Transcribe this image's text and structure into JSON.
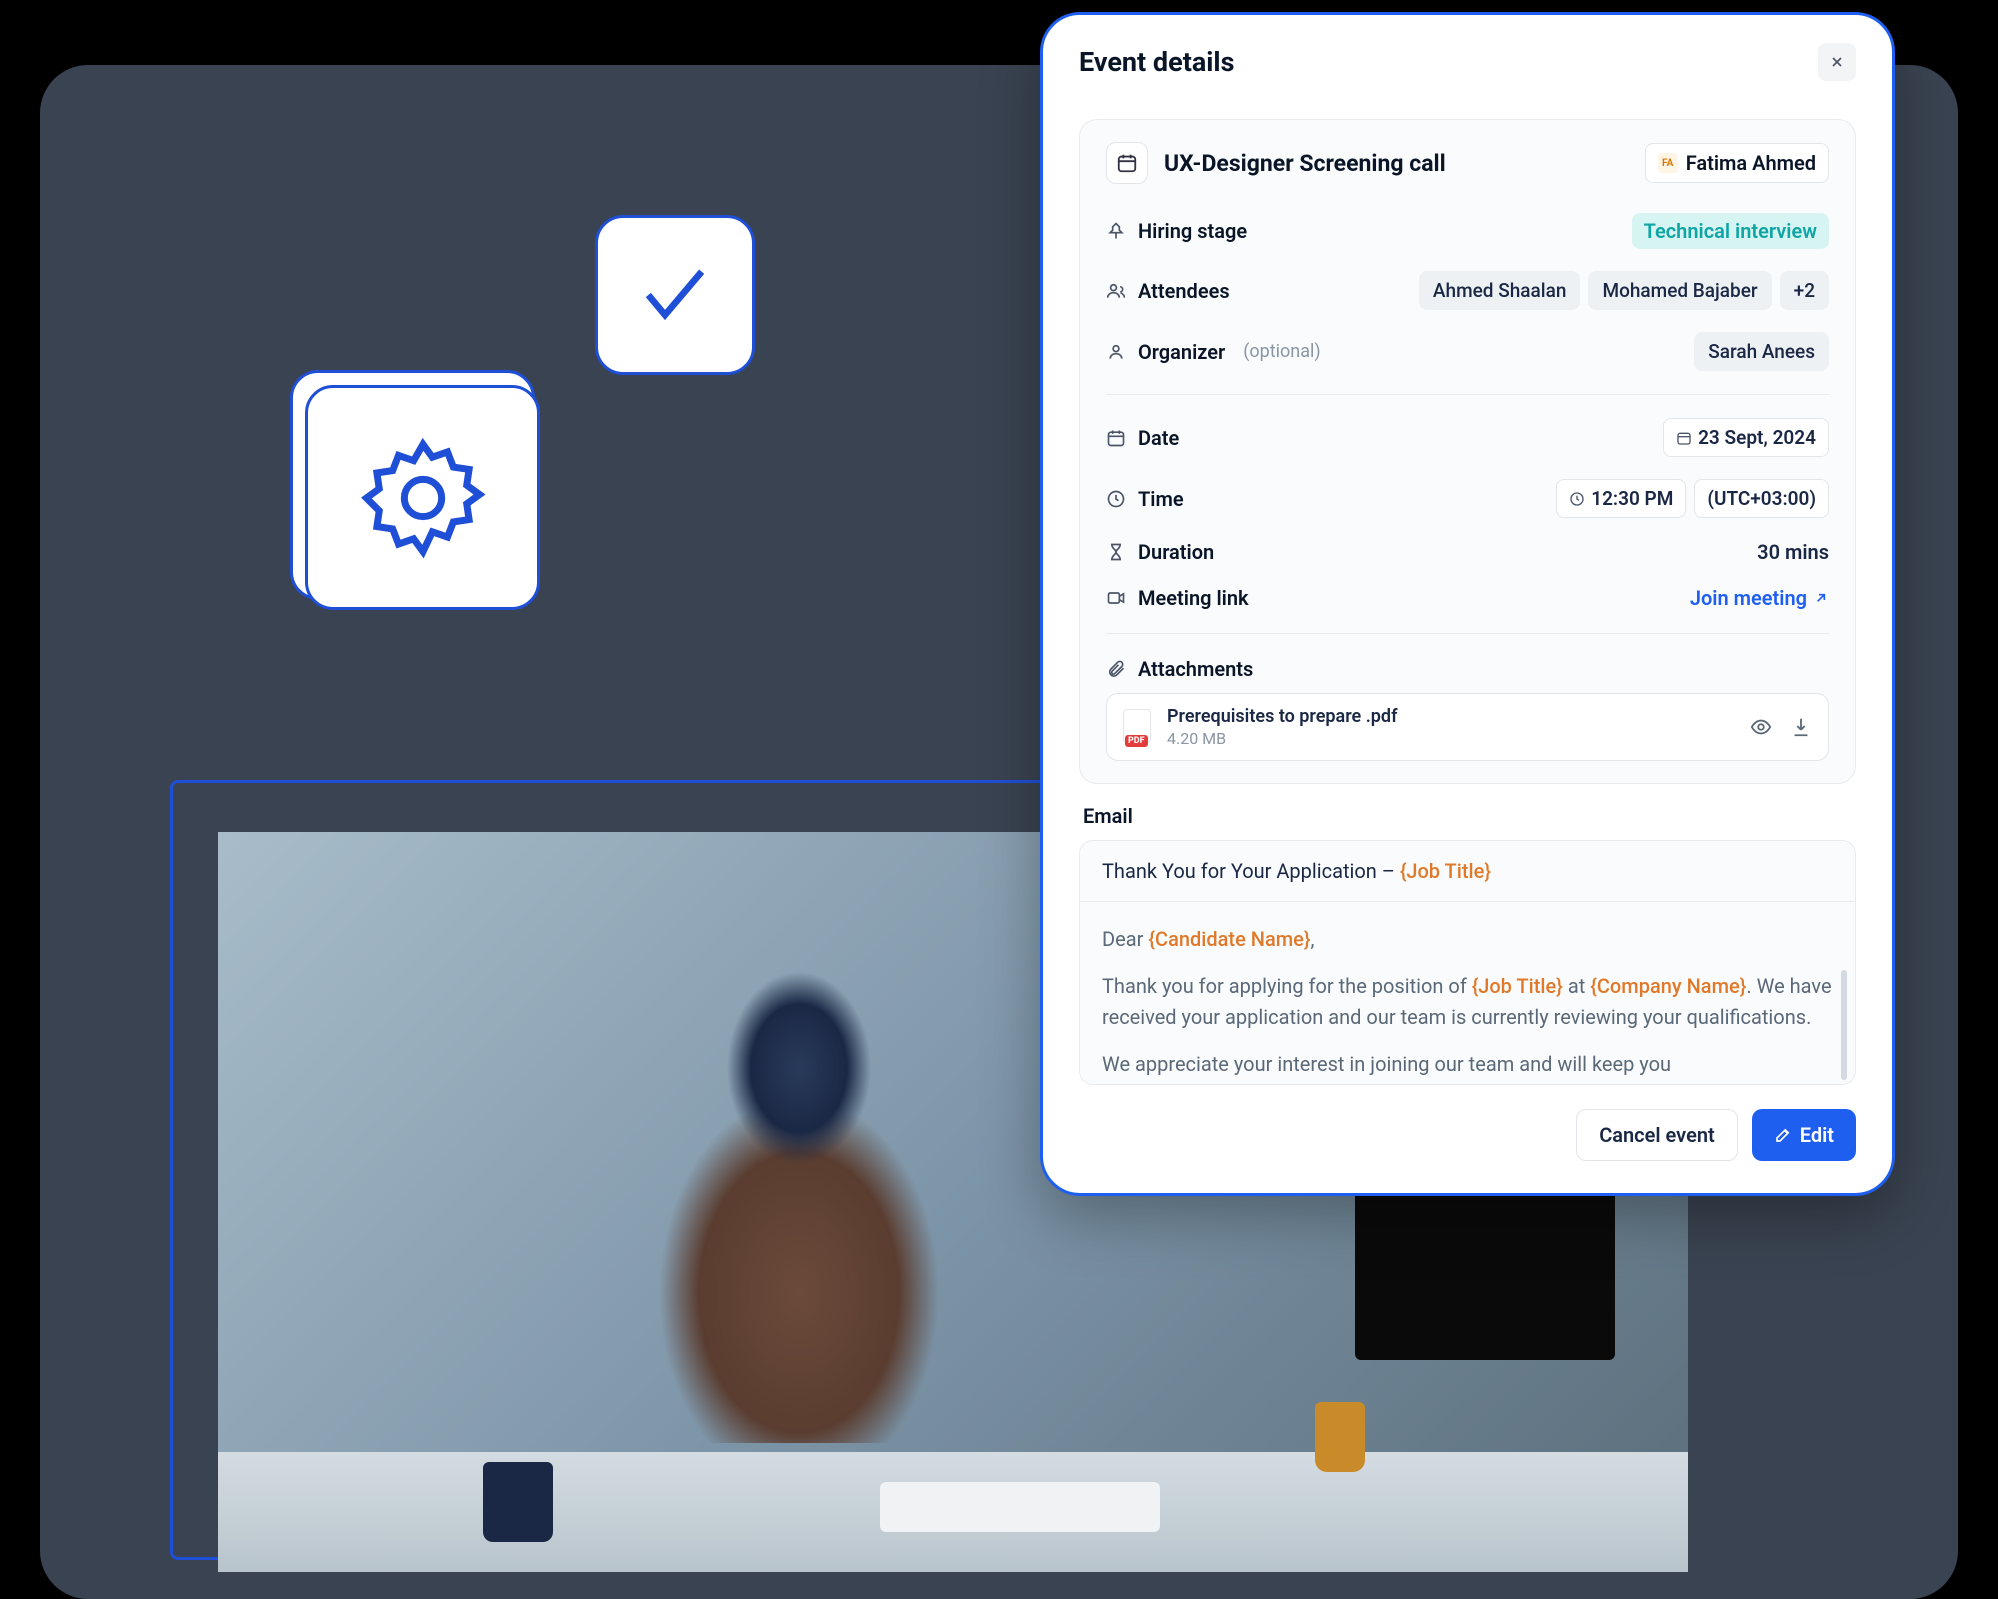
{
  "modal": {
    "title": "Event details",
    "close_label": "Close",
    "event": {
      "title": "UX-Designer Screening call",
      "candidate_initials": "FA",
      "candidate_name": "Fatima Ahmed"
    },
    "stage": {
      "label": "Hiring stage",
      "value": "Technical interview"
    },
    "attendees": {
      "label": "Attendees",
      "items": [
        "Ahmed Shaalan",
        "Mohamed Bajaber"
      ],
      "more": "+2"
    },
    "organizer": {
      "label": "Organizer",
      "optional": "(optional)",
      "value": "Sarah Anees"
    },
    "date": {
      "label": "Date",
      "value": "23 Sept, 2024"
    },
    "time": {
      "label": "Time",
      "value": "12:30 PM",
      "tz": "(UTC+03:00)"
    },
    "duration": {
      "label": "Duration",
      "value": "30 mins"
    },
    "meeting": {
      "label": "Meeting link",
      "action": "Join meeting"
    },
    "attachments": {
      "label": "Attachments",
      "file": {
        "name": "Prerequisites to prepare .pdf",
        "size": "4.20 MB",
        "badge": "PDF"
      }
    },
    "email": {
      "label": "Email",
      "subject_plain": "Thank You for Your Application – ",
      "subject_token": "{Job Title}",
      "body_dear": "Dear ",
      "body_candidate": "{Candidate Name}",
      "body_comma": ",",
      "body_l1a": "Thank you for applying for the position of ",
      "body_job": "{Job Title}",
      "body_l1b": " at ",
      "body_company": "{Company Name}",
      "body_l1c": ". We have received your application and our team is currently reviewing your qualifications.",
      "body_l2": "We appreciate your interest in joining our team and will keep you"
    },
    "footer": {
      "cancel": "Cancel event",
      "edit": "Edit"
    }
  }
}
